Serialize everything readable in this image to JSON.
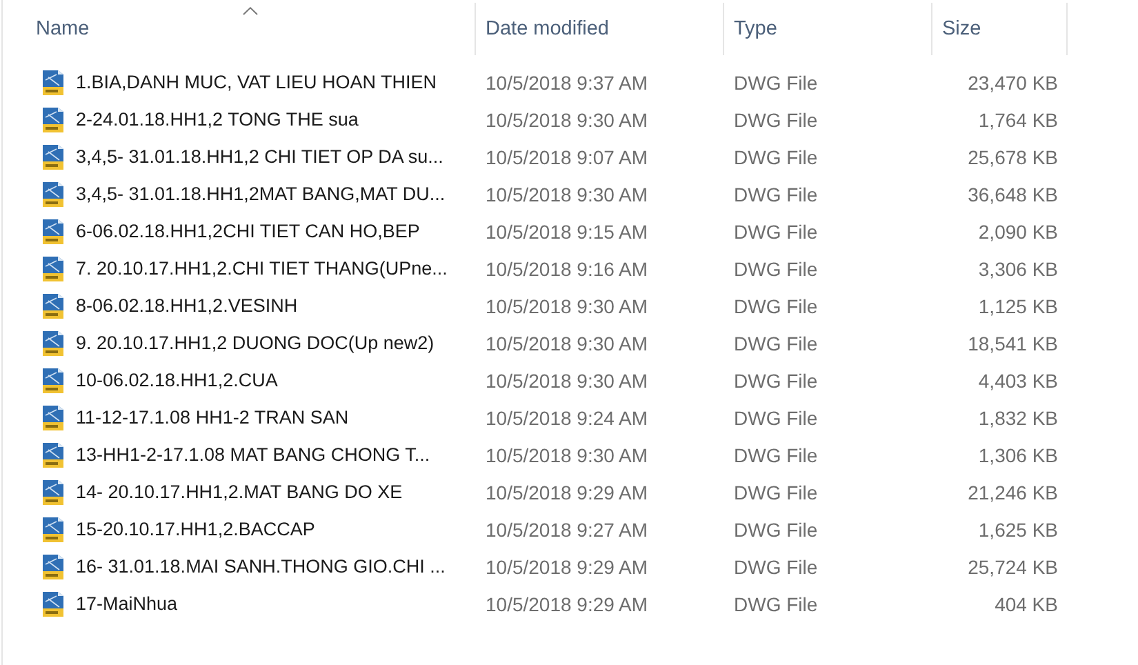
{
  "columns": [
    {
      "label": "Name",
      "sorted": true
    },
    {
      "label": "Date modified",
      "sorted": false
    },
    {
      "label": "Type",
      "sorted": false
    },
    {
      "label": "Size",
      "sorted": false
    }
  ],
  "files": [
    {
      "name": "1.BIA,DANH MUC, VAT LIEU HOAN THIEN",
      "date": "10/5/2018 9:37 AM",
      "type": "DWG File",
      "size": "23,470 KB"
    },
    {
      "name": "2-24.01.18.HH1,2 TONG THE sua",
      "date": "10/5/2018 9:30 AM",
      "type": "DWG File",
      "size": "1,764 KB"
    },
    {
      "name": "3,4,5- 31.01.18.HH1,2 CHI TIET OP DA  su...",
      "date": "10/5/2018 9:07 AM",
      "type": "DWG File",
      "size": "25,678 KB"
    },
    {
      "name": "3,4,5- 31.01.18.HH1,2MAT BANG,MAT DU...",
      "date": "10/5/2018 9:30 AM",
      "type": "DWG File",
      "size": "36,648 KB"
    },
    {
      "name": "6-06.02.18.HH1,2CHI TIET CAN HO,BEP",
      "date": "10/5/2018 9:15 AM",
      "type": "DWG File",
      "size": "2,090 KB"
    },
    {
      "name": "7. 20.10.17.HH1,2.CHI TIET THANG(UPne...",
      "date": "10/5/2018 9:16 AM",
      "type": "DWG File",
      "size": "3,306 KB"
    },
    {
      "name": "8-06.02.18.HH1,2.VESINH",
      "date": "10/5/2018 9:30 AM",
      "type": "DWG File",
      "size": "1,125 KB"
    },
    {
      "name": "9. 20.10.17.HH1,2 DUONG DOC(Up new2)",
      "date": "10/5/2018 9:30 AM",
      "type": "DWG File",
      "size": "18,541 KB"
    },
    {
      "name": "10-06.02.18.HH1,2.CUA",
      "date": "10/5/2018 9:30 AM",
      "type": "DWG File",
      "size": "4,403 KB"
    },
    {
      "name": "11-12-17.1.08 HH1-2 TRAN SAN",
      "date": "10/5/2018 9:24 AM",
      "type": "DWG File",
      "size": "1,832 KB"
    },
    {
      "name": "13-HH1-2-17.1.08 MAT BANG CHONG T...",
      "date": "10/5/2018 9:30 AM",
      "type": "DWG File",
      "size": "1,306 KB"
    },
    {
      "name": "14- 20.10.17.HH1,2.MAT BANG DO XE",
      "date": "10/5/2018 9:29 AM",
      "type": "DWG File",
      "size": "21,246 KB"
    },
    {
      "name": "15-20.10.17.HH1,2.BACCAP",
      "date": "10/5/2018 9:27 AM",
      "type": "DWG File",
      "size": "1,625 KB"
    },
    {
      "name": "16- 31.01.18.MAI SANH.THONG GIO.CHI ...",
      "date": "10/5/2018 9:29 AM",
      "type": "DWG File",
      "size": "25,724 KB"
    },
    {
      "name": "17-MaiNhua",
      "date": "10/5/2018 9:29 AM",
      "type": "DWG File",
      "size": "404 KB"
    }
  ]
}
